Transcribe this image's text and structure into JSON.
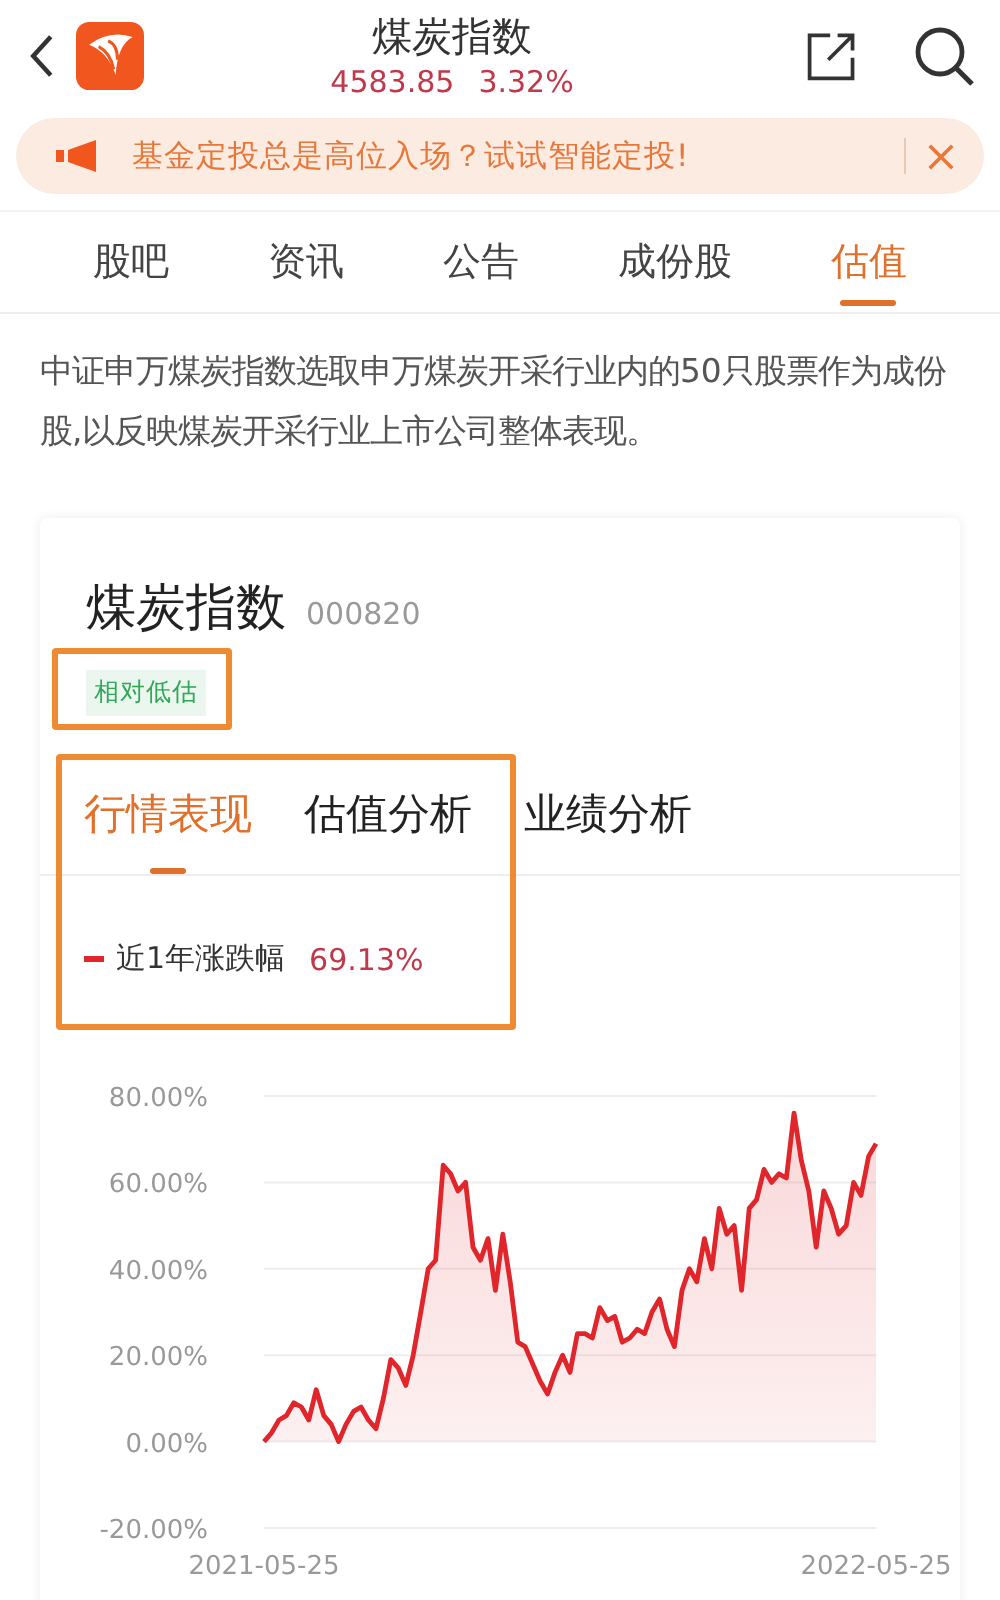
{
  "header": {
    "title": "煤炭指数",
    "price": "4583.85",
    "change": "3.32%"
  },
  "banner": {
    "text": "基金定投总是高位入场？试试智能定投!"
  },
  "tabs": [
    {
      "label": "股吧",
      "selected": false
    },
    {
      "label": "资讯",
      "selected": false
    },
    {
      "label": "公告",
      "selected": false
    },
    {
      "label": "成份股",
      "selected": false
    },
    {
      "label": "估值",
      "selected": true
    }
  ],
  "description": "中证申万煤炭指数选取申万煤炭开采行业内的50只股票作为成份股,以反映煤炭开采行业上市公司整体表现。",
  "card": {
    "title": "煤炭指数",
    "code": "000820",
    "tag": "相对低估",
    "tabs": [
      {
        "label": "行情表现",
        "selected": true
      },
      {
        "label": "估值分析",
        "selected": false
      },
      {
        "label": "业绩分析",
        "selected": false
      }
    ],
    "legend_value": "69.13%",
    "chart_data": {
      "type": "area",
      "grid": true,
      "ylim": [
        -20,
        80
      ],
      "categories": [
        "2021-05-25",
        null,
        null,
        null,
        null,
        null,
        null,
        null,
        null,
        null,
        null,
        null,
        null,
        null,
        null,
        null,
        null,
        null,
        null,
        null,
        null,
        null,
        null,
        null,
        null,
        null,
        null,
        null,
        null,
        null,
        null,
        null,
        null,
        null,
        null,
        null,
        null,
        null,
        null,
        null,
        null,
        null,
        null,
        null,
        null,
        null,
        null,
        null,
        null,
        null,
        null,
        null,
        null,
        null,
        null,
        null,
        null,
        null,
        null,
        null,
        null,
        null,
        null,
        null,
        null,
        null,
        null,
        null,
        null,
        null,
        null,
        null,
        null,
        null,
        null,
        null,
        null,
        null,
        null,
        null,
        null,
        null,
        "2022-05-25"
      ],
      "yticks": [
        {
          "value": 80,
          "label": "80.00%"
        },
        {
          "value": 60,
          "label": "60.00%"
        },
        {
          "value": 40,
          "label": "40.00%"
        },
        {
          "value": 20,
          "label": "20.00%"
        },
        {
          "value": 0,
          "label": "0.00%"
        },
        {
          "value": -20,
          "label": "-20.00%"
        }
      ],
      "series": [
        {
          "name": "近1年涨跌幅",
          "color": "#e0262b",
          "values": [
            0,
            2,
            5,
            6,
            9,
            8,
            5,
            12,
            6,
            4,
            0,
            4,
            7,
            8,
            5,
            3,
            10,
            19,
            17,
            13,
            20,
            30,
            40,
            42,
            64,
            62,
            58,
            60,
            45,
            42,
            47,
            35,
            48,
            37,
            23,
            22,
            18,
            14,
            11,
            16,
            20,
            16,
            25,
            25,
            24,
            31,
            28,
            29,
            23,
            24,
            26,
            25,
            30,
            33,
            26,
            22,
            35,
            40,
            37,
            47,
            40,
            54,
            48,
            50,
            35,
            54,
            56,
            63,
            60,
            62,
            61,
            76,
            65,
            58,
            45,
            58,
            54,
            48,
            50,
            60,
            57,
            66,
            69
          ]
        }
      ]
    }
  }
}
